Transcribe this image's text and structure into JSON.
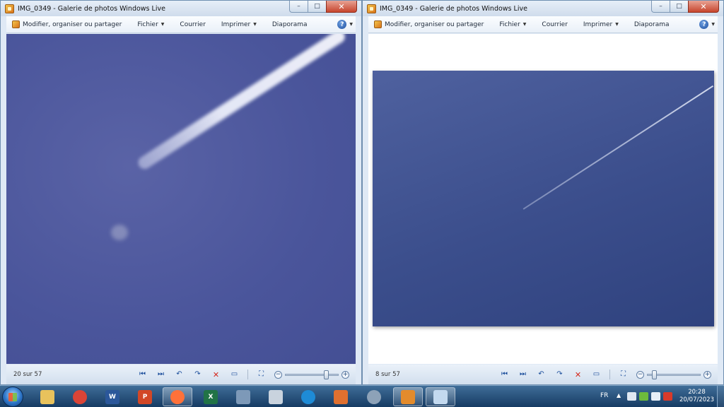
{
  "windows": [
    {
      "title": "IMG_0349 - Galerie de photos Windows Live",
      "menu": {
        "organize_label": "Modifier, organiser ou partager",
        "file_label": "Fichier",
        "mail_label": "Courrier",
        "print_label": "Imprimer",
        "slideshow_label": "Diaporama"
      },
      "status": {
        "counter": "20 sur 57"
      },
      "zoom_level": 0.78
    },
    {
      "title": "IMG_0349 - Galerie de photos Windows Live",
      "menu": {
        "organize_label": "Modifier, organiser ou partager",
        "file_label": "Fichier",
        "mail_label": "Courrier",
        "print_label": "Imprimer",
        "slideshow_label": "Diaporama"
      },
      "status": {
        "counter": "8 sur 57"
      },
      "zoom_level": 0.08
    }
  ],
  "icons": {
    "help": "?",
    "dropdown_caret": "▼",
    "minimize": "–",
    "maximize": "□",
    "close": "✕",
    "previous": "⏮",
    "next": "⏭",
    "rotate_left": "↶",
    "rotate_right": "↷",
    "delete": "✕",
    "slideshow": "▭",
    "fit": "⛶",
    "zoom_minus": "−",
    "zoom_plus": "+"
  },
  "taskbar": {
    "apps": [
      {
        "name": "explorer",
        "glyph": "",
        "color": "#e8c25c"
      },
      {
        "name": "chrome",
        "glyph": "",
        "color": "#db4437"
      },
      {
        "name": "word",
        "glyph": "W",
        "color": "#2b579a"
      },
      {
        "name": "powerpoint",
        "glyph": "P",
        "color": "#d24726"
      },
      {
        "name": "firefox",
        "glyph": "",
        "color": "#ff7139"
      },
      {
        "name": "excel",
        "glyph": "X",
        "color": "#217346"
      },
      {
        "name": "network",
        "glyph": "",
        "color": "#7d99b8"
      },
      {
        "name": "calculator",
        "glyph": "",
        "color": "#c9d3de"
      },
      {
        "name": "edge",
        "glyph": "",
        "color": "#1e8bd6"
      },
      {
        "name": "media",
        "glyph": "",
        "color": "#e0702f"
      },
      {
        "name": "disc",
        "glyph": "",
        "color": "#8da2b8"
      },
      {
        "name": "photo-gallery",
        "glyph": "",
        "color": "#e38b2c"
      },
      {
        "name": "paint",
        "glyph": "",
        "color": "#c3d9ef"
      }
    ],
    "language": "FR",
    "tray_arrow": "▲",
    "time": "20:28",
    "date": "20/07/2023"
  },
  "colors": {
    "tray_network": "#dfe8f2",
    "tray_sync": "#6dbb3c",
    "tray_volume": "#e6eef6",
    "tray_alert": "#d83a2a"
  }
}
